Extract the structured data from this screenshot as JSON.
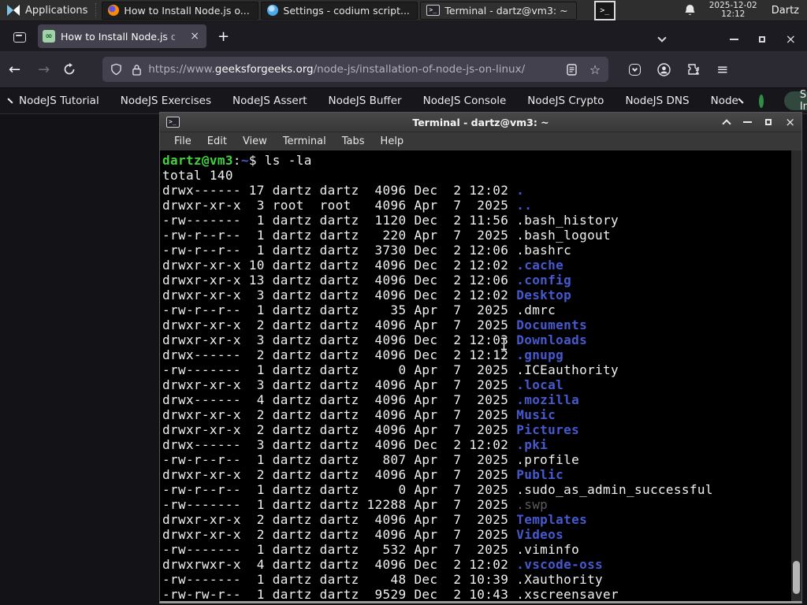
{
  "panel": {
    "applications_label": "Applications",
    "windows": [
      {
        "title": "How to Install Node.js o...",
        "app": "firefox"
      },
      {
        "title": "Settings - codium script...",
        "app": "vscodium"
      },
      {
        "title": "Terminal - dartz@vm3: ~",
        "app": "terminal"
      }
    ],
    "clock_date": "2025-12-02",
    "clock_time": "12:12",
    "user": "Dartz"
  },
  "browser": {
    "tab_title": "How to Install Node.js on",
    "favicon_glyph": "∞",
    "url": {
      "scheme_www": "https://www.",
      "domain": "geeksforgeeks.org",
      "path": "/node-js/installation-of-node-js-on-linux/"
    }
  },
  "icons": {
    "back": "←",
    "forward": "→",
    "close": "×",
    "plus": "+",
    "hamburger": "≡",
    "star": "☆",
    "terminal_glyph": ">_"
  },
  "site_nav": {
    "links": [
      "NodeJS Tutorial",
      "NodeJS Exercises",
      "NodeJS Assert",
      "NodeJS Buffer",
      "NodeJS Console",
      "NodeJS Crypto",
      "NodeJS DNS",
      "Node"
    ],
    "sign_in_label": "Sign In"
  },
  "colors": {
    "gfg_green": "#2f8d46",
    "prompt_green": "#3fd33f",
    "dir_blue": "#4659cf",
    "term_bg": "#000000"
  },
  "terminal": {
    "window_title": "Terminal - dartz@vm3: ~",
    "menu": [
      "File",
      "Edit",
      "View",
      "Terminal",
      "Tabs",
      "Help"
    ],
    "prompt": {
      "user_host": "dartz@vm3",
      "separator": ":",
      "cwd": "~",
      "symbol": "$",
      "command": "ls -la"
    },
    "total_line": "total 140",
    "files": [
      {
        "perms": "drwx------",
        "links": "17",
        "owner": "dartz",
        "group": "dartz",
        "size": "4096",
        "month": "Dec",
        "day": "2",
        "time": "12:02",
        "name": ".",
        "type": "dir"
      },
      {
        "perms": "drwxr-xr-x",
        "links": "3",
        "owner": "root",
        "group": "root",
        "size": "4096",
        "month": "Apr",
        "day": "7",
        "time": "2025",
        "name": "..",
        "type": "dir"
      },
      {
        "perms": "-rw-------",
        "links": "1",
        "owner": "dartz",
        "group": "dartz",
        "size": "1120",
        "month": "Dec",
        "day": "2",
        "time": "11:56",
        "name": ".bash_history",
        "type": "file"
      },
      {
        "perms": "-rw-r--r--",
        "links": "1",
        "owner": "dartz",
        "group": "dartz",
        "size": "220",
        "month": "Apr",
        "day": "7",
        "time": "2025",
        "name": ".bash_logout",
        "type": "file"
      },
      {
        "perms": "-rw-r--r--",
        "links": "1",
        "owner": "dartz",
        "group": "dartz",
        "size": "3730",
        "month": "Dec",
        "day": "2",
        "time": "12:06",
        "name": ".bashrc",
        "type": "file"
      },
      {
        "perms": "drwxr-xr-x",
        "links": "10",
        "owner": "dartz",
        "group": "dartz",
        "size": "4096",
        "month": "Dec",
        "day": "2",
        "time": "12:02",
        "name": ".cache",
        "type": "dir"
      },
      {
        "perms": "drwxr-xr-x",
        "links": "13",
        "owner": "dartz",
        "group": "dartz",
        "size": "4096",
        "month": "Dec",
        "day": "2",
        "time": "12:06",
        "name": ".config",
        "type": "dir"
      },
      {
        "perms": "drwxr-xr-x",
        "links": "3",
        "owner": "dartz",
        "group": "dartz",
        "size": "4096",
        "month": "Dec",
        "day": "2",
        "time": "12:02",
        "name": "Desktop",
        "type": "dir"
      },
      {
        "perms": "-rw-r--r--",
        "links": "1",
        "owner": "dartz",
        "group": "dartz",
        "size": "35",
        "month": "Apr",
        "day": "7",
        "time": "2025",
        "name": ".dmrc",
        "type": "file"
      },
      {
        "perms": "drwxr-xr-x",
        "links": "2",
        "owner": "dartz",
        "group": "dartz",
        "size": "4096",
        "month": "Apr",
        "day": "7",
        "time": "2025",
        "name": "Documents",
        "type": "dir"
      },
      {
        "perms": "drwxr-xr-x",
        "links": "3",
        "owner": "dartz",
        "group": "dartz",
        "size": "4096",
        "month": "Dec",
        "day": "2",
        "time": "12:03",
        "name": "Downloads",
        "type": "dir"
      },
      {
        "perms": "drwx------",
        "links": "2",
        "owner": "dartz",
        "group": "dartz",
        "size": "4096",
        "month": "Dec",
        "day": "2",
        "time": "12:12",
        "name": ".gnupg",
        "type": "dir"
      },
      {
        "perms": "-rw-------",
        "links": "1",
        "owner": "dartz",
        "group": "dartz",
        "size": "0",
        "month": "Apr",
        "day": "7",
        "time": "2025",
        "name": ".ICEauthority",
        "type": "file"
      },
      {
        "perms": "drwxr-xr-x",
        "links": "3",
        "owner": "dartz",
        "group": "dartz",
        "size": "4096",
        "month": "Apr",
        "day": "7",
        "time": "2025",
        "name": ".local",
        "type": "dir"
      },
      {
        "perms": "drwx------",
        "links": "4",
        "owner": "dartz",
        "group": "dartz",
        "size": "4096",
        "month": "Apr",
        "day": "7",
        "time": "2025",
        "name": ".mozilla",
        "type": "dir"
      },
      {
        "perms": "drwxr-xr-x",
        "links": "2",
        "owner": "dartz",
        "group": "dartz",
        "size": "4096",
        "month": "Apr",
        "day": "7",
        "time": "2025",
        "name": "Music",
        "type": "dir"
      },
      {
        "perms": "drwxr-xr-x",
        "links": "2",
        "owner": "dartz",
        "group": "dartz",
        "size": "4096",
        "month": "Apr",
        "day": "7",
        "time": "2025",
        "name": "Pictures",
        "type": "dir"
      },
      {
        "perms": "drwx------",
        "links": "3",
        "owner": "dartz",
        "group": "dartz",
        "size": "4096",
        "month": "Dec",
        "day": "2",
        "time": "12:02",
        "name": ".pki",
        "type": "dir"
      },
      {
        "perms": "-rw-r--r--",
        "links": "1",
        "owner": "dartz",
        "group": "dartz",
        "size": "807",
        "month": "Apr",
        "day": "7",
        "time": "2025",
        "name": ".profile",
        "type": "file"
      },
      {
        "perms": "drwxr-xr-x",
        "links": "2",
        "owner": "dartz",
        "group": "dartz",
        "size": "4096",
        "month": "Apr",
        "day": "7",
        "time": "2025",
        "name": "Public",
        "type": "dir"
      },
      {
        "perms": "-rw-r--r--",
        "links": "1",
        "owner": "dartz",
        "group": "dartz",
        "size": "0",
        "month": "Apr",
        "day": "7",
        "time": "2025",
        "name": ".sudo_as_admin_successful",
        "type": "file"
      },
      {
        "perms": "-rw-------",
        "links": "1",
        "owner": "dartz",
        "group": "dartz",
        "size": "12288",
        "month": "Apr",
        "day": "7",
        "time": "2025",
        "name": ".swp",
        "type": "dim"
      },
      {
        "perms": "drwxr-xr-x",
        "links": "2",
        "owner": "dartz",
        "group": "dartz",
        "size": "4096",
        "month": "Apr",
        "day": "7",
        "time": "2025",
        "name": "Templates",
        "type": "dir"
      },
      {
        "perms": "drwxr-xr-x",
        "links": "2",
        "owner": "dartz",
        "group": "dartz",
        "size": "4096",
        "month": "Apr",
        "day": "7",
        "time": "2025",
        "name": "Videos",
        "type": "dir"
      },
      {
        "perms": "-rw-------",
        "links": "1",
        "owner": "dartz",
        "group": "dartz",
        "size": "532",
        "month": "Apr",
        "day": "7",
        "time": "2025",
        "name": ".viminfo",
        "type": "file"
      },
      {
        "perms": "drwxrwxr-x",
        "links": "4",
        "owner": "dartz",
        "group": "dartz",
        "size": "4096",
        "month": "Dec",
        "day": "2",
        "time": "12:02",
        "name": ".vscode-oss",
        "type": "dir"
      },
      {
        "perms": "-rw-------",
        "links": "1",
        "owner": "dartz",
        "group": "dartz",
        "size": "48",
        "month": "Dec",
        "day": "2",
        "time": "10:39",
        "name": ".Xauthority",
        "type": "file"
      },
      {
        "perms": "-rw-rw-r--",
        "links": "1",
        "owner": "dartz",
        "group": "dartz",
        "size": "9529",
        "month": "Dec",
        "day": "2",
        "time": "10:43",
        "name": ".xscreensaver",
        "type": "file"
      }
    ]
  }
}
